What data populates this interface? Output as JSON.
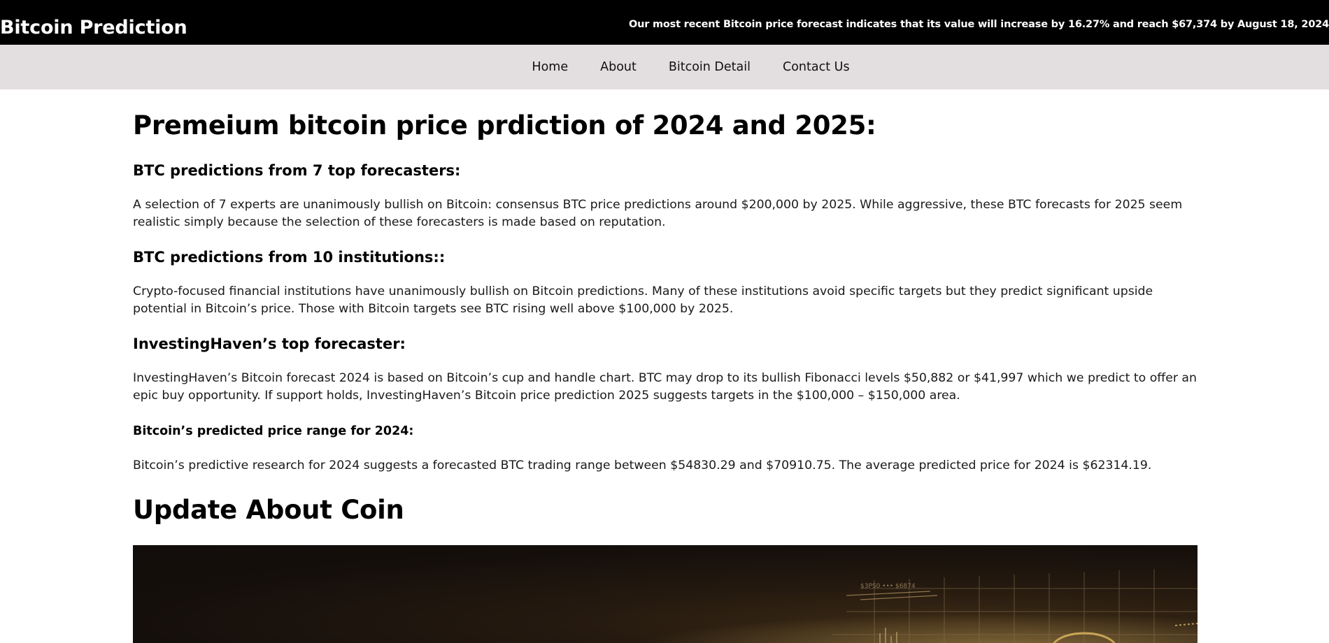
{
  "header": {
    "brand": "Bitcoin Prediction",
    "ticker": "Our most recent Bitcoin price forecast indicates that its value will increase by 16.27% and reach $67,374 by August 18, 2024"
  },
  "nav": {
    "items": [
      {
        "label": "Home"
      },
      {
        "label": "About"
      },
      {
        "label": "Bitcoin Detail"
      },
      {
        "label": "Contact Us"
      }
    ]
  },
  "main": {
    "title": "Premeium bitcoin price prdiction of 2024 and 2025:",
    "sections": [
      {
        "heading": "BTC predictions from 7 top forecasters:",
        "text": "A selection of 7 experts are unanimously bullish on Bitcoin: consensus BTC price predictions around $200,000 by 2025. While aggressive, these BTC forecasts for 2025 seem realistic simply because the selection of these forecasters is made based on reputation."
      },
      {
        "heading": "BTC predictions from 10 institutions::",
        "text": "Crypto-focused financial institutions have unanimously bullish on Bitcoin predictions. Many of these institutions avoid specific targets but they predict significant upside potential in Bitcoin’s price. Those with Bitcoin targets see BTC rising well above $100,000 by 2025."
      },
      {
        "heading": "InvestingHaven’s top forecaster:",
        "text": "InvestingHaven’s Bitcoin forecast 2024 is based on Bitcoin’s cup and handle chart. BTC may drop to its bullish Fibonacci levels $50,882 or $41,997 which we predict to offer an epic buy opportunity. If support holds, InvestingHaven’s Bitcoin price prediction 2025 suggests targets in the $100,000 – $150,000 area."
      },
      {
        "heading": "Bitcoin’s predicted price range for 2024:",
        "text": "Bitcoin’s predictive research for 2024 suggests a forecasted BTC trading range between $54830.29 and $70910.75. The average predicted price for 2024 is $62314.19."
      }
    ],
    "update_title": "Update About Coin",
    "hero_caption": "$3PS0 ••• $6874"
  },
  "colors": {
    "topbar": "#000000",
    "navbar": "#e3dedf",
    "hero_dark": "#150f0b",
    "hero_gold": "#c8a45a"
  }
}
